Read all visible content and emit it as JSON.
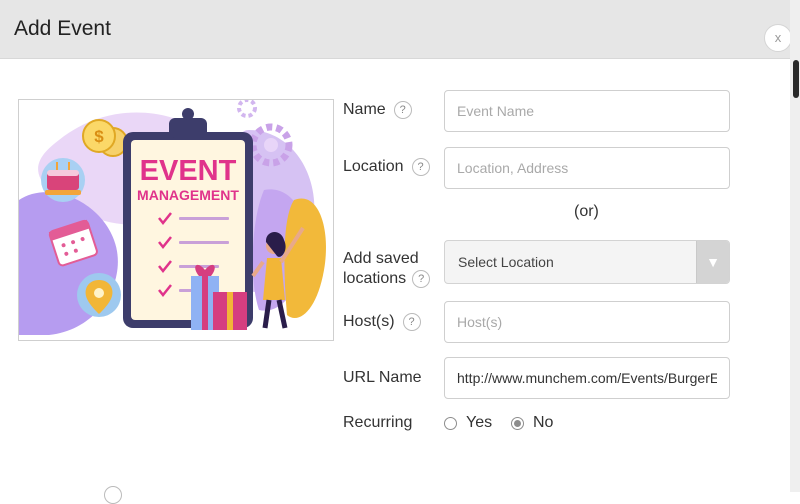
{
  "dialog": {
    "title": "Add Event",
    "close_label": "x"
  },
  "illustration": {
    "event_text": "EVENT",
    "management_text": "MANAGEMENT"
  },
  "form": {
    "name": {
      "label": "Name",
      "placeholder": "Event Name",
      "help": "?"
    },
    "location": {
      "label": "Location",
      "placeholder": "Location, Address",
      "help": "?"
    },
    "or_text": "(or)",
    "saved_locations": {
      "label_line1": "Add saved",
      "label_line2": "locations",
      "help": "?",
      "selected": "Select Location",
      "arrow": "▼"
    },
    "hosts": {
      "label": "Host(s)",
      "placeholder": "Host(s)",
      "help": "?"
    },
    "url_name": {
      "label": "URL Name",
      "value": "http://www.munchem.com/Events/BurgerEm"
    },
    "recurring": {
      "label": "Recurring",
      "options": [
        {
          "label": "Yes",
          "checked": false
        },
        {
          "label": "No",
          "checked": true
        }
      ]
    }
  }
}
